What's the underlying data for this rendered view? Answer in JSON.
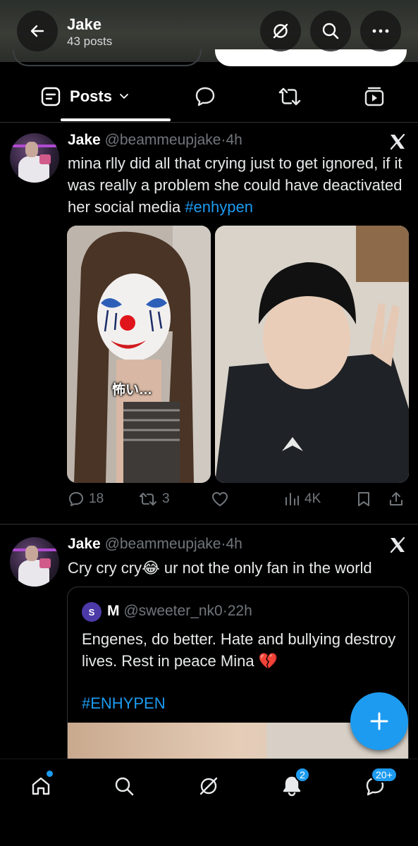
{
  "header": {
    "title": "Jake",
    "subtitle": "43 posts",
    "icons": [
      "back-arrow-icon",
      "grok-icon",
      "search-icon",
      "more-icon"
    ]
  },
  "tabs": [
    {
      "label": "Posts",
      "icon": "posts-icon",
      "active": true
    },
    {
      "label": "",
      "icon": "replies-icon"
    },
    {
      "label": "",
      "icon": "reposts-icon"
    },
    {
      "label": "",
      "icon": "media-icon"
    }
  ],
  "posts": [
    {
      "name": "Jake",
      "handle": "@beammeupjake",
      "sep": "·",
      "time": "4h",
      "text": "mina rlly did all that crying just to get ignored, if it was really a problem she could have deactivated her social media ",
      "hashtag": "#enhypen",
      "image_overlay_text": "怖い…",
      "replies": "18",
      "reposts": "3",
      "views": "4K"
    },
    {
      "name": "Jake",
      "handle": "@beammeupjake",
      "sep": "·",
      "time": "4h",
      "text": "Cry cry cry😂 ur not the only fan in the world",
      "quote": {
        "avatar_letter": "S",
        "name": "M",
        "handle": "@sweeter_nk0",
        "sep": "·",
        "time": "22h",
        "text": "Engenes, do better. Hate and bullying destroy lives. Rest in peace Mina 💔",
        "hashtag": "#ENHYPEN"
      }
    }
  ],
  "bottom_nav": {
    "items": [
      "home-icon",
      "search-icon",
      "grok-icon",
      "notifications-icon",
      "messages-icon"
    ],
    "notifications_badge": "2",
    "messages_badge": "20+"
  },
  "colors": {
    "accent": "#1d9bf0",
    "muted": "#71767b",
    "background": "#000000"
  }
}
